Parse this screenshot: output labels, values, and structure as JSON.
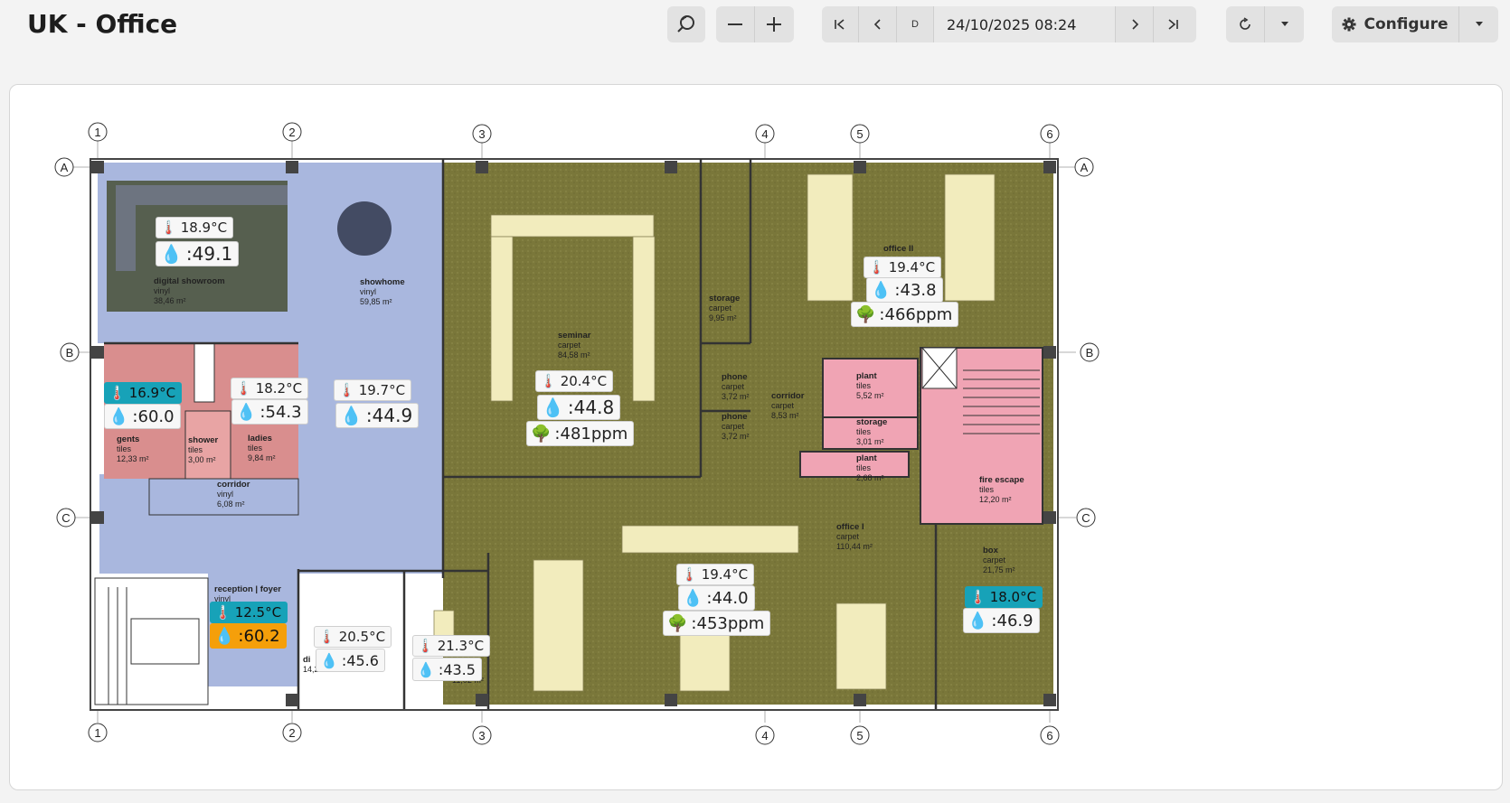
{
  "header": {
    "title": "UK - Office",
    "date_mode": "D",
    "datetime": "24/10/2025 08:24",
    "configure_label": "Configure"
  },
  "icons": {
    "search": "search-icon",
    "zoom_out": "minus-icon",
    "zoom_in": "plus-icon",
    "first": "skip-first-icon",
    "prev": "chevron-left-icon",
    "next": "chevron-right-icon",
    "last": "skip-last-icon",
    "refresh": "refresh-icon",
    "dropdown": "caret-down-icon",
    "gear": "gear-icon",
    "temp": "thermometer-icon",
    "humidity": "droplet-icon",
    "co2": "tree-icon"
  },
  "colors": {
    "cold": "#17a2b8",
    "warn": "#f59f0a",
    "carpet": "#7d7a3c",
    "vinyl": "#a9b7de",
    "tiles": "#e9a0a8"
  },
  "grid": {
    "cols": [
      "1",
      "2",
      "3",
      "4",
      "5",
      "6"
    ],
    "rows": [
      "A",
      "B",
      "C"
    ]
  },
  "rooms": [
    {
      "name": "digital showroom",
      "material": "vinyl",
      "area": "38,46 m²"
    },
    {
      "name": "showhome",
      "material": "vinyl",
      "area": "59,85 m²"
    },
    {
      "name": "seminar",
      "material": "carpet",
      "area": "84,58 m²"
    },
    {
      "name": "storage",
      "material": "carpet",
      "area": "9,95 m²"
    },
    {
      "name": "office II",
      "material": "",
      "area": ""
    },
    {
      "name": "phone",
      "material": "carpet",
      "area": "3,72 m²"
    },
    {
      "name": "phone",
      "material": "carpet",
      "area": "3,72 m²"
    },
    {
      "name": "corridor",
      "material": "carpet",
      "area": "8,53 m²"
    },
    {
      "name": "plant",
      "material": "tiles",
      "area": "5,52 m²"
    },
    {
      "name": "storage",
      "material": "tiles",
      "area": "3,01 m²"
    },
    {
      "name": "plant",
      "material": "tiles",
      "area": "2,68 m²"
    },
    {
      "name": "fire escape",
      "material": "tiles",
      "area": "12,20 m²"
    },
    {
      "name": "gents",
      "material": "tiles",
      "area": "12,33 m²"
    },
    {
      "name": "shower",
      "material": "tiles",
      "area": "3,00 m²"
    },
    {
      "name": "ladies",
      "material": "tiles",
      "area": "9,84 m²"
    },
    {
      "name": "corridor",
      "material": "vinyl",
      "area": "6,08 m²"
    },
    {
      "name": "office I",
      "material": "carpet",
      "area": "110,44 m²"
    },
    {
      "name": "box",
      "material": "carpet",
      "area": "21,75 m²"
    },
    {
      "name": "reception | foyer",
      "material": "vinyl",
      "area": ""
    },
    {
      "name": "di",
      "material": "",
      "area": "14,28 m²"
    },
    {
      "name": "",
      "material": "",
      "area": "11,02 m²"
    }
  ],
  "sensors": [
    {
      "temp": "18.9°C",
      "hum": ":49.1",
      "co2": "",
      "temp_status": "normal",
      "hum_status": "normal"
    },
    {
      "temp": "19.4°C",
      "hum": ":43.8",
      "co2": ":466ppm",
      "temp_status": "normal",
      "hum_status": "normal"
    },
    {
      "temp": "20.4°C",
      "hum": ":44.8",
      "co2": ":481ppm",
      "temp_status": "normal",
      "hum_status": "normal"
    },
    {
      "temp": "16.9°C",
      "hum": ":60.0",
      "co2": "",
      "temp_status": "cold",
      "hum_status": "normal"
    },
    {
      "temp": "18.2°C",
      "hum": ":54.3",
      "co2": "",
      "temp_status": "normal",
      "hum_status": "normal"
    },
    {
      "temp": "19.7°C",
      "hum": ":44.9",
      "co2": "",
      "temp_status": "normal",
      "hum_status": "normal"
    },
    {
      "temp": "19.4°C",
      "hum": ":44.0",
      "co2": ":453ppm",
      "temp_status": "normal",
      "hum_status": "normal"
    },
    {
      "temp": "18.0°C",
      "hum": ":46.9",
      "co2": "",
      "temp_status": "cold",
      "hum_status": "normal"
    },
    {
      "temp": "12.5°C",
      "hum": ":60.2",
      "co2": "",
      "temp_status": "cold",
      "hum_status": "warn"
    },
    {
      "temp": "20.5°C",
      "hum": ":45.6",
      "co2": "",
      "temp_status": "normal",
      "hum_status": "normal"
    },
    {
      "temp": "21.3°C",
      "hum": ":43.5",
      "co2": "",
      "temp_status": "normal",
      "hum_status": "normal"
    }
  ]
}
